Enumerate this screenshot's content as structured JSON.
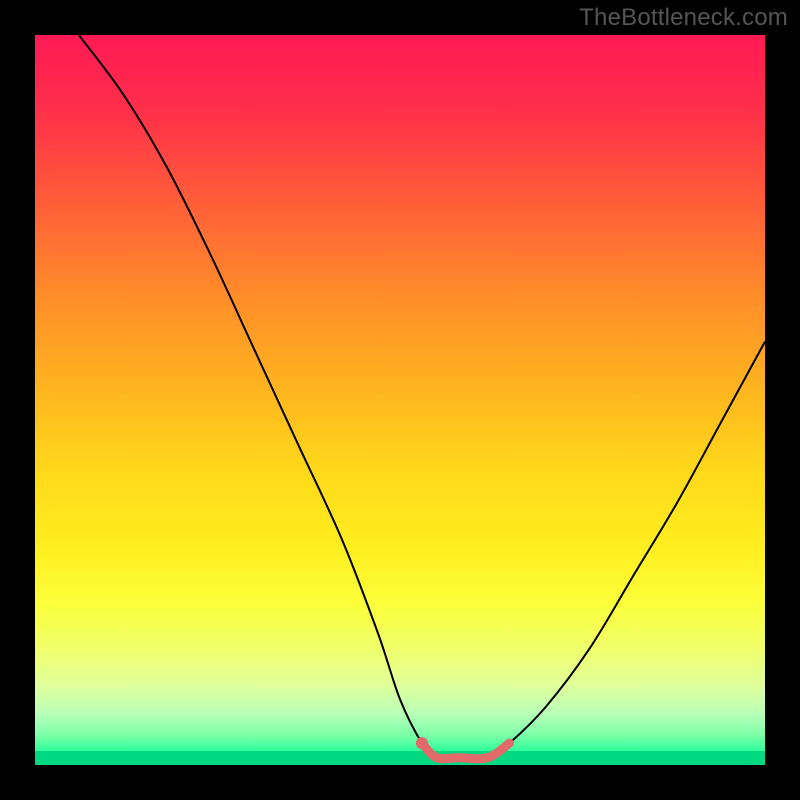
{
  "watermark": "TheBottleneck.com",
  "chart_data": {
    "type": "line",
    "title": "",
    "xlabel": "",
    "ylabel": "",
    "xlim": [
      0,
      100
    ],
    "ylim": [
      0,
      100
    ],
    "series": [
      {
        "name": "bottleneck-curve",
        "x": [
          6,
          12,
          18,
          24,
          30,
          36,
          42,
          47,
          50,
          53,
          55,
          58,
          62,
          65,
          70,
          76,
          82,
          88,
          94,
          100
        ],
        "y": [
          100,
          92,
          82,
          70,
          57,
          44,
          31,
          18,
          9,
          3,
          1,
          1,
          1,
          3,
          8,
          16,
          26,
          36,
          47,
          58
        ]
      },
      {
        "name": "optimal-range-highlight",
        "x": [
          53,
          55,
          58,
          62,
          65
        ],
        "y": [
          3,
          1,
          1,
          1,
          3
        ]
      }
    ],
    "annotations": [],
    "colors": {
      "curve": "#000000",
      "highlight": "#e26a6a",
      "gradient_top": "#ff1a55",
      "gradient_bottom": "#00d982"
    }
  }
}
